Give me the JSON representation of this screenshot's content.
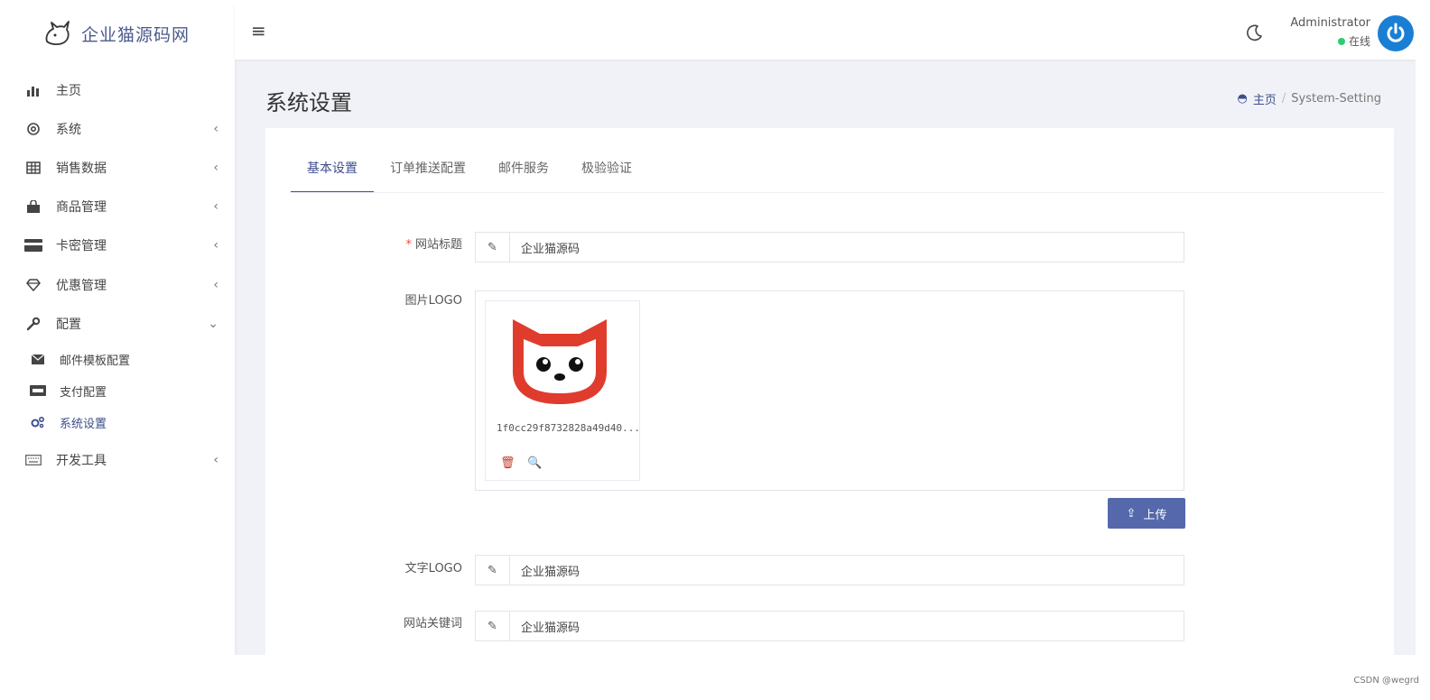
{
  "brand": {
    "name": "企业猫源码网"
  },
  "sidebar": {
    "items": [
      {
        "label": "主页",
        "icon": "bar-chart-icon",
        "has_arrow": false
      },
      {
        "label": "系统",
        "icon": "settings-icon",
        "has_arrow": true
      },
      {
        "label": "销售数据",
        "icon": "table-icon",
        "has_arrow": true
      },
      {
        "label": "商品管理",
        "icon": "shopping-bag-icon",
        "has_arrow": true
      },
      {
        "label": "卡密管理",
        "icon": "credit-card-icon",
        "has_arrow": true
      },
      {
        "label": "优惠管理",
        "icon": "diamond-icon",
        "has_arrow": true
      },
      {
        "label": "配置",
        "icon": "wrench-icon",
        "has_arrow": true,
        "expanded": true
      },
      {
        "label": "开发工具",
        "icon": "keyboard-icon",
        "has_arrow": true
      }
    ],
    "sub_items": [
      {
        "label": "邮件模板配置",
        "icon": "envelope-icon"
      },
      {
        "label": "支付配置",
        "icon": "payment-card-icon"
      },
      {
        "label": "系统设置",
        "icon": "cogs-icon",
        "active": true
      }
    ]
  },
  "topbar": {
    "menu_icon": "hamburger-icon",
    "theme_icon": "moon-icon",
    "user_name": "Administrator",
    "user_status": "在线",
    "status_color": "#2ecc71",
    "avatar_icon": "power-icon"
  },
  "page": {
    "title": "系统设置",
    "breadcrumb_home": "主页",
    "breadcrumb_current": "System-Setting"
  },
  "tabs": [
    "基本设置",
    "订单推送配置",
    "邮件服务",
    "极验验证"
  ],
  "form": {
    "site_title_label": "网站标题",
    "site_title_value": "企业猫源码",
    "logo_label": "图片LOGO",
    "logo_file_name": "1f0cc29f8732828a49d40...",
    "upload_label": "上传",
    "text_logo_label": "文字LOGO",
    "text_logo_value": "企业猫源码",
    "keywords_label": "网站关键词",
    "keywords_value": "企业猫源码"
  },
  "colors": {
    "accent": "#3d4e8c",
    "button": "#5568ab",
    "logo_red": "#e03c2d",
    "avatar_blue": "#1a7fd4"
  },
  "watermark": "CSDN @wegrd"
}
